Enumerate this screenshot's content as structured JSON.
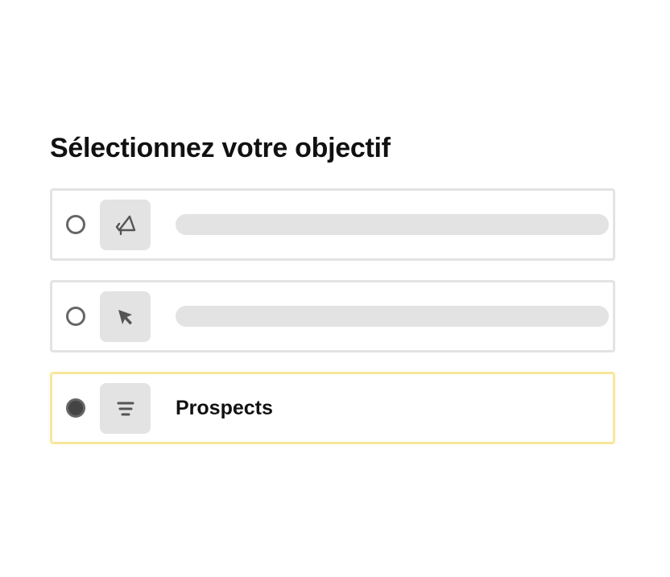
{
  "page": {
    "title": "Sélectionnez votre objectif"
  },
  "options": [
    {
      "icon": "megaphone-icon",
      "label": "",
      "selected": false
    },
    {
      "icon": "cursor-arrow-icon",
      "label": "",
      "selected": false
    },
    {
      "icon": "filter-lines-icon",
      "label": "Prospects",
      "selected": true
    }
  ],
  "colors": {
    "selected_border": "#f8e79a",
    "default_border": "#e3e3e3",
    "icon_tile": "#e3e3e3",
    "icon_stroke": "#555555",
    "radio_checked": "#444444"
  }
}
